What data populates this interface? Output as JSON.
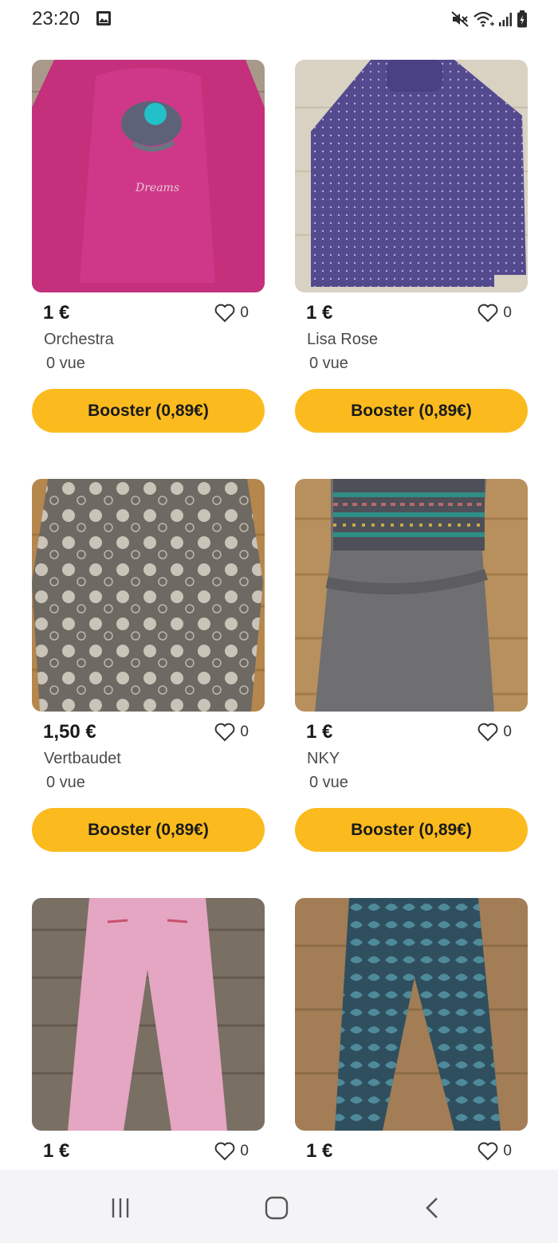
{
  "status_bar": {
    "time": "23:20",
    "left_icon": "image-notification-icon",
    "right_icons": [
      "mute-icon",
      "wifi-icon",
      "signal-icon",
      "battery-icon"
    ]
  },
  "colors": {
    "booster": "#fbbb1e",
    "nav_bg": "#f4f4f7"
  },
  "listings": [
    {
      "price": "1 €",
      "likes": "0",
      "brand": "Orchestra",
      "views": "0 vue",
      "booster_label": "Booster (0,89€)",
      "image": "pink-long-sleeve-top"
    },
    {
      "price": "1 €",
      "likes": "0",
      "brand": "Lisa Rose",
      "views": "0 vue",
      "booster_label": "Booster (0,89€)",
      "image": "purple-polka-dot-turtleneck"
    },
    {
      "price": "1,50 €",
      "likes": "0",
      "brand": "Vertbaudet",
      "views": "0 vue",
      "booster_label": "Booster (0,89€)",
      "image": "grey-patterned-dress"
    },
    {
      "price": "1 €",
      "likes": "0",
      "brand": "NKY",
      "views": "0 vue",
      "booster_label": "Booster (0,89€)",
      "image": "grey-knit-dress"
    },
    {
      "price": "1 €",
      "likes": "0",
      "image": "pink-trousers"
    },
    {
      "price": "1 €",
      "likes": "0",
      "image": "blue-patterned-trousers"
    }
  ],
  "nav_bar": {
    "buttons": [
      "recents-icon",
      "home-icon",
      "back-icon"
    ]
  }
}
